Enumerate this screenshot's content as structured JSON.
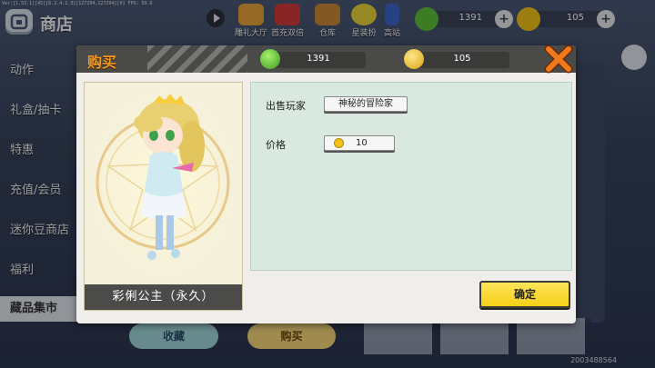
{
  "debug_line": "Ver:[1.53.1][45][6.2.4.1.3][127294,127294][0] FPS: 59.6",
  "header": {
    "title": "商店",
    "nav_icons": [
      {
        "label": "雕礼大厅",
        "icon": "gift-hall-icon"
      },
      {
        "label": "首充双倍",
        "icon": "double-topup-icon"
      },
      {
        "label": "仓库",
        "icon": "warehouse-icon"
      },
      {
        "label": "星装扮",
        "icon": "star-outfit-icon"
      },
      {
        "label": "高站",
        "icon": "tall-station-icon"
      }
    ],
    "gems": "1391",
    "coins": "105"
  },
  "sidebar": {
    "items": [
      "动作",
      "礼盒/抽卡",
      "特惠",
      "充值/会员",
      "迷你豆商店",
      "福利",
      "藏品集市"
    ],
    "active_index": 6
  },
  "bottom": {
    "collect_label": "收藏",
    "buy_label": "购买",
    "id_text": "2003488564"
  },
  "dialog": {
    "title": "购买",
    "gems": "1391",
    "coins": "105",
    "item_name": "彩俐公主（永久）",
    "seller_label": "出售玩家",
    "seller_value": "神秘的冒险家",
    "price_label": "价格",
    "price_value": "10",
    "confirm_label": "确定"
  },
  "colors": {
    "title_orange": "#f39a1c",
    "confirm_yellow": "#f6cf18",
    "gem_green": "#5cbf3a",
    "coin_gold": "#f0c21a",
    "info_panel": "#d9e9df"
  }
}
